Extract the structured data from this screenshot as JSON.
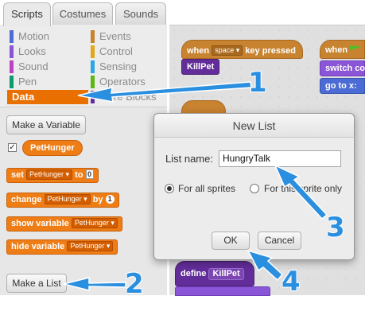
{
  "tabs": [
    {
      "label": "Scripts"
    },
    {
      "label": "Costumes"
    },
    {
      "label": "Sounds"
    }
  ],
  "categories": {
    "left": [
      {
        "label": "Motion",
        "color": "#4a6cd4"
      },
      {
        "label": "Looks",
        "color": "#8a55d7"
      },
      {
        "label": "Sound",
        "color": "#bb42c3"
      },
      {
        "label": "Pen",
        "color": "#0e9a6c"
      },
      {
        "label": "Data",
        "color": "#ee7d16",
        "selected": true
      }
    ],
    "right": [
      {
        "label": "Events",
        "color": "#c88330"
      },
      {
        "label": "Control",
        "color": "#e1a91a"
      },
      {
        "label": "Sensing",
        "color": "#2ca5e2"
      },
      {
        "label": "Operators",
        "color": "#5cb712"
      },
      {
        "label": "More Blocks",
        "color": "#632d99"
      }
    ]
  },
  "palette": {
    "make_variable": "Make a Variable",
    "variable_name": "PetHunger",
    "make_list": "Make a List",
    "blocks": {
      "set": {
        "word1": "set",
        "var": "PetHunger",
        "word2": "to",
        "value": "0"
      },
      "change": {
        "word1": "change",
        "var": "PetHunger",
        "word2": "by",
        "value": "1"
      },
      "show": {
        "word1": "show variable",
        "var": "PetHunger"
      },
      "hide": {
        "word1": "hide variable",
        "var": "PetHunger"
      }
    }
  },
  "scripts": {
    "hat1": {
      "word1": "when",
      "key": "space",
      "word2": "key pressed"
    },
    "killpet_call": "KillPet",
    "hat2": {
      "word1": "when"
    },
    "switch": "switch co",
    "goto": "go to x:",
    "define": {
      "word": "define",
      "name": "KillPet"
    }
  },
  "dialog": {
    "title": "New List",
    "name_label": "List name:",
    "name_value": "HungryTalk",
    "option_all": "For all sprites",
    "option_this": "For this sprite only",
    "ok": "OK",
    "cancel": "Cancel"
  },
  "callouts": [
    "1",
    "2",
    "3",
    "4"
  ],
  "colors": {
    "data": "#ee7d16",
    "annotation": "#2b8fe0"
  }
}
